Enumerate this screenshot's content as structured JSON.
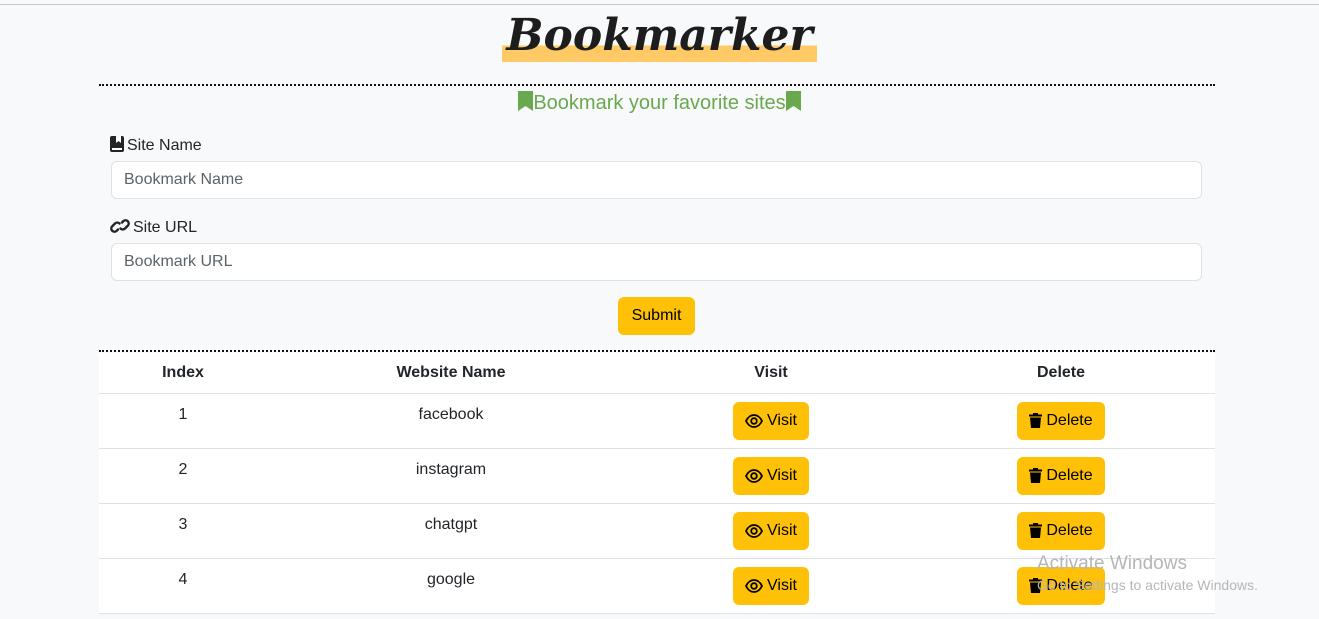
{
  "brand": {
    "title": "Bookmarker"
  },
  "tagline": "Bookmark your favorite sites",
  "form": {
    "site_name_label": "Site Name",
    "site_name_placeholder": "Bookmark Name",
    "site_url_label": "Site URL",
    "site_url_placeholder": "Bookmark URL",
    "submit_label": "Submit"
  },
  "table": {
    "headers": [
      "Index",
      "Website Name",
      "Visit",
      "Delete"
    ],
    "rows": [
      {
        "index": "1",
        "name": "facebook",
        "visit_label": "Visit",
        "delete_label": "Delete"
      },
      {
        "index": "2",
        "name": "instagram",
        "visit_label": "Visit",
        "delete_label": "Delete"
      },
      {
        "index": "3",
        "name": "chatgpt",
        "visit_label": "Visit",
        "delete_label": "Delete"
      },
      {
        "index": "4",
        "name": "google",
        "visit_label": "Visit",
        "delete_label": "Delete"
      }
    ]
  },
  "watermark": {
    "line1": "Activate Windows",
    "line2": "Go to Settings to activate Windows."
  },
  "colors": {
    "accent": "#ffc107",
    "tagline": "#6aa84f",
    "logo_highlight": "#ffc966"
  }
}
